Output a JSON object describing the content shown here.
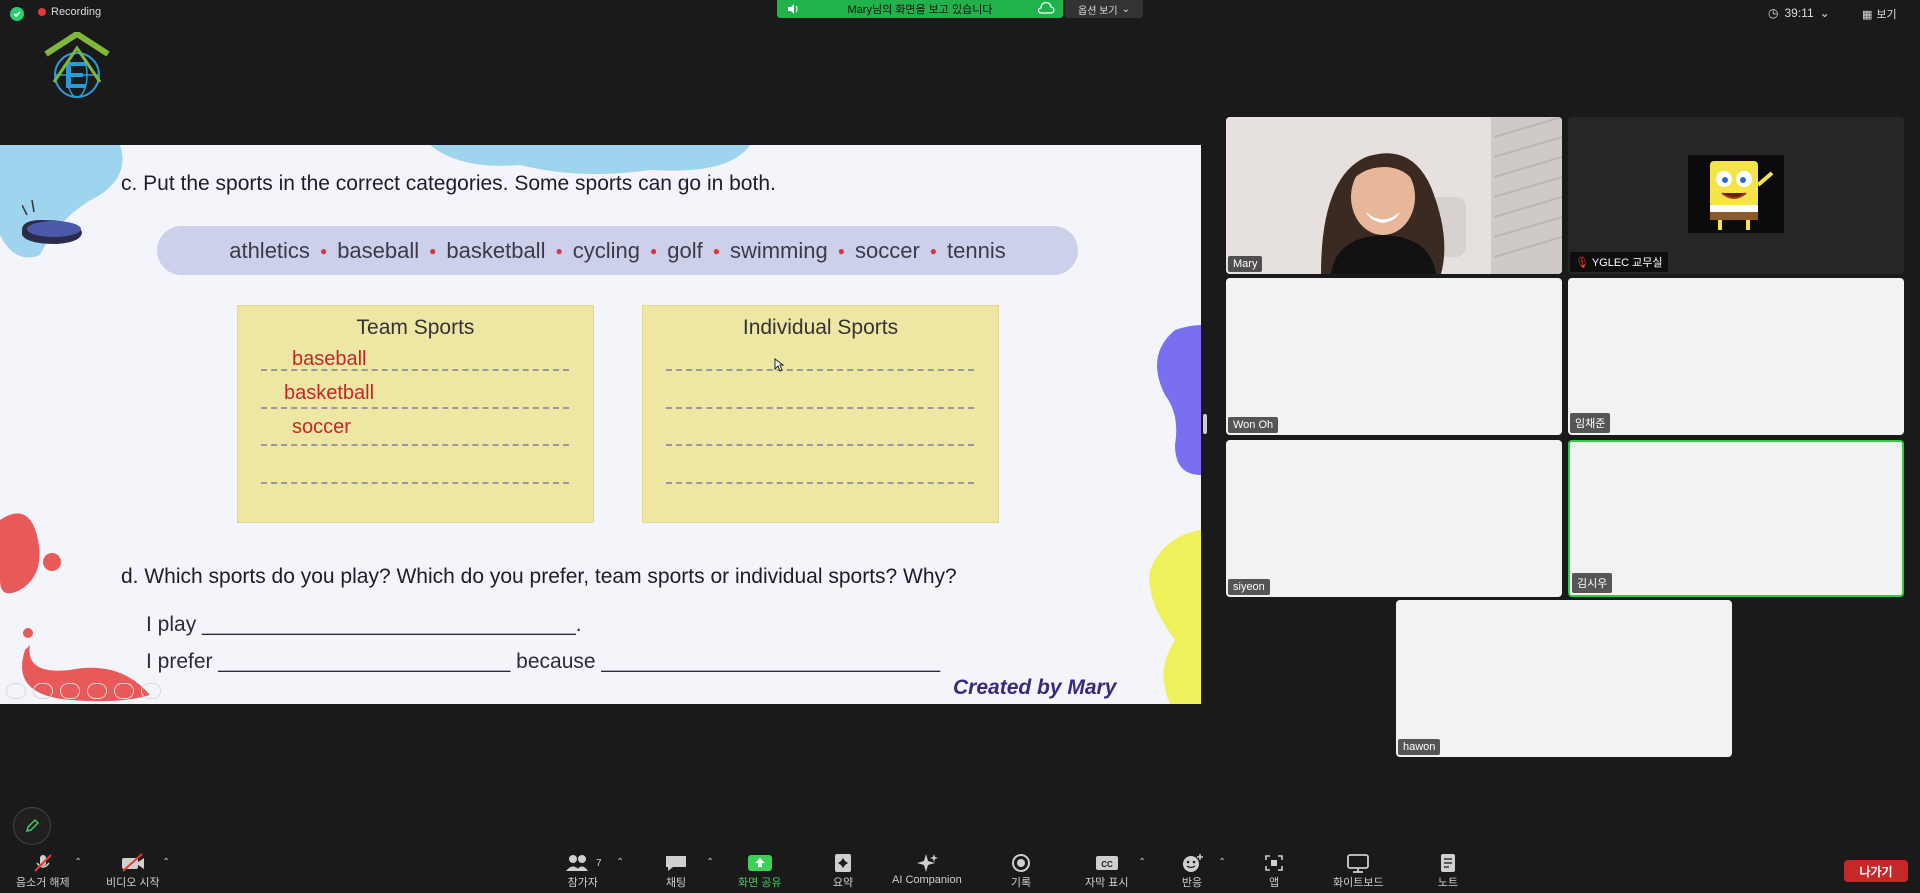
{
  "status": {
    "recording": "Recording",
    "timer": "39:11",
    "view": "보기"
  },
  "share_banner": {
    "text": "Mary님의 화면을 보고 있습니다",
    "options": "옵션 보기"
  },
  "slide": {
    "q_c": "c. Put the sports in the correct categories. Some sports can go in both.",
    "word_bank": [
      "athletics",
      "baseball",
      "basketball",
      "cycling",
      "golf",
      "swimming",
      "soccer",
      "tennis"
    ],
    "team_title": "Team Sports",
    "individual_title": "Individual Sports",
    "team_answers": [
      "baseball",
      "basketball",
      "soccer"
    ],
    "q_d": "d. Which sports do you play? Which do you prefer, team sports or individual sports? Why?",
    "line_play": "I play ________________________________.",
    "line_prefer": "I prefer _________________________ because _____________________________",
    "credit": "Created by Mary"
  },
  "participants": [
    {
      "name": "Mary",
      "video": true
    },
    {
      "name": "YGLEC 교무실",
      "muted": true
    },
    {
      "name": "Won Oh"
    },
    {
      "name": "임채준"
    },
    {
      "name": "siyeon"
    },
    {
      "name": "김시우",
      "active": true
    },
    {
      "name": "hawon"
    }
  ],
  "toolbar": {
    "unmute": "음소거 해제",
    "start_video": "비디오 시작",
    "participants": "참가자",
    "participants_count": "7",
    "chat": "채팅",
    "share": "화면 공유",
    "summary": "요약",
    "ai": "AI Companion",
    "record": "기록",
    "captions": "자막 표시",
    "reactions": "반응",
    "apps": "앱",
    "whiteboard": "화이트보드",
    "notes": "노트",
    "leave": "나가기"
  },
  "colors": {
    "accent_green": "#21b34b",
    "leave_red": "#c62828",
    "answer_red": "#c6262a"
  }
}
